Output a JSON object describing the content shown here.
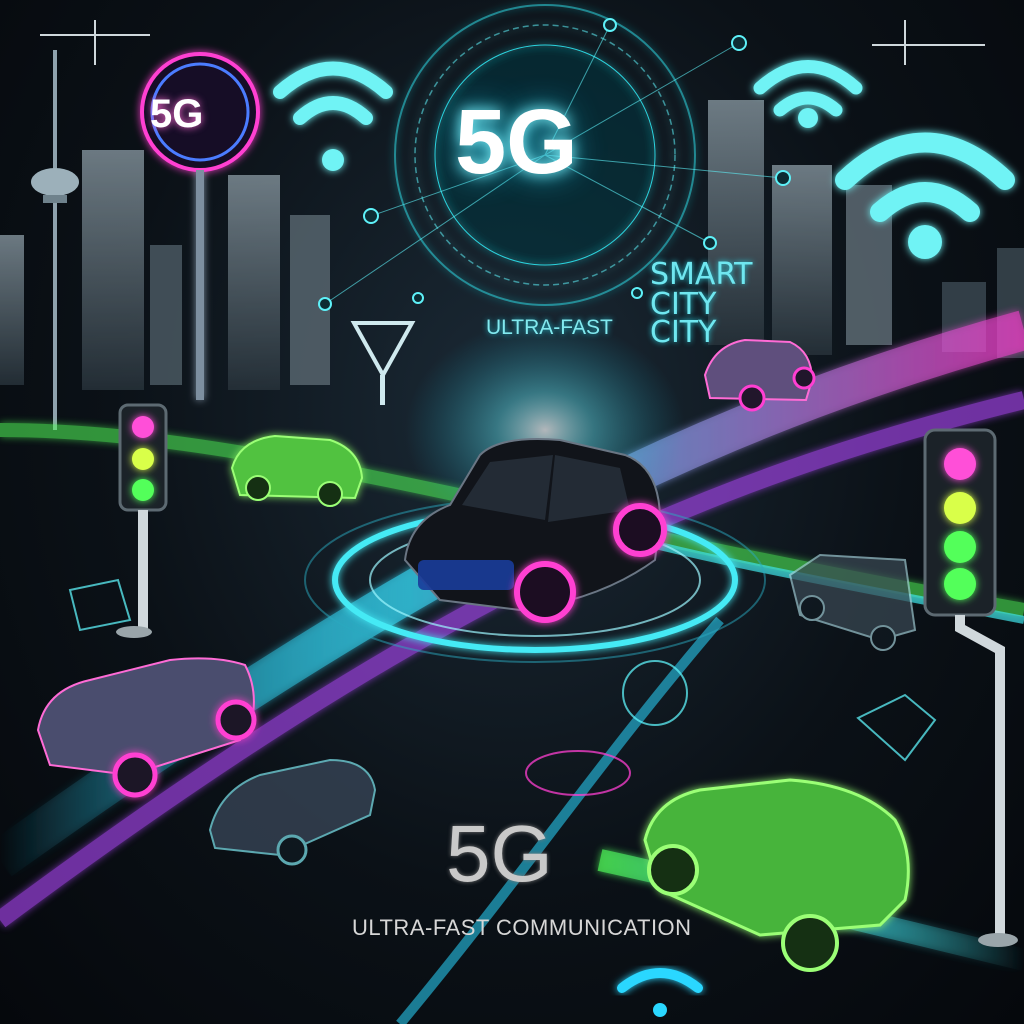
{
  "hero_label": "5G",
  "tower_label": "5G",
  "smart_city_line1": "SMART",
  "smart_city_line2": "CITY",
  "smart_city_line3": "CITY",
  "ultra_fast_label": "ULTRA-FAST",
  "bottom_label": "5G",
  "caption": "ULTRA-FAST COMMUNICATION",
  "colors": {
    "cyan_glow": "#34e6f0",
    "magenta_glow": "#ff3fd2",
    "green_glow": "#52ff5a",
    "purple_glow": "#a34cff",
    "road": "#1a2129"
  }
}
